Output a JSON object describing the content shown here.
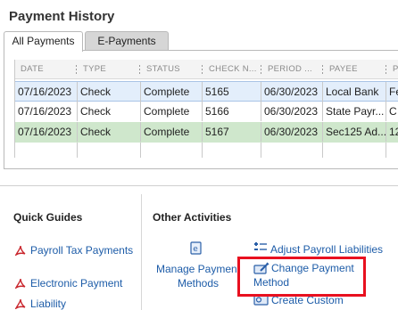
{
  "page": {
    "title": "Payment History"
  },
  "tabs": [
    {
      "label": "All Payments",
      "active": true
    },
    {
      "label": "E-Payments",
      "active": false
    }
  ],
  "grid": {
    "columns": [
      "DATE",
      "TYPE",
      "STATUS",
      "CHECK N...",
      "PERIOD ...",
      "PAYEE",
      "P"
    ],
    "rows": [
      {
        "date": "07/16/2023",
        "type": "Check",
        "status": "Complete",
        "check": "5165",
        "period": "06/30/2023",
        "payee": "Local Bank",
        "p": "Fe"
      },
      {
        "date": "07/16/2023",
        "type": "Check",
        "status": "Complete",
        "check": "5166",
        "period": "06/30/2023",
        "payee": "State Payr...",
        "p": "C"
      },
      {
        "date": "07/16/2023",
        "type": "Check",
        "status": "Complete",
        "check": "5167",
        "period": "06/30/2023",
        "payee": "Sec125 Ad...",
        "p": "12"
      }
    ]
  },
  "quick_guides": {
    "title": "Quick Guides",
    "items": [
      "Payroll Tax Payments",
      "Electronic Payment",
      "Liability"
    ]
  },
  "other_activities": {
    "title": "Other Activities",
    "manage": "Manage Payment Methods",
    "adjust": "Adjust Payroll Liabilities",
    "change": "Change Payment Method",
    "create": "Create Custom Payments"
  },
  "colors": {
    "link": "#1d5ca8",
    "highlight": "#e8101f",
    "selected_row": "#e3eefb",
    "green_row": "#cfe7cc"
  }
}
